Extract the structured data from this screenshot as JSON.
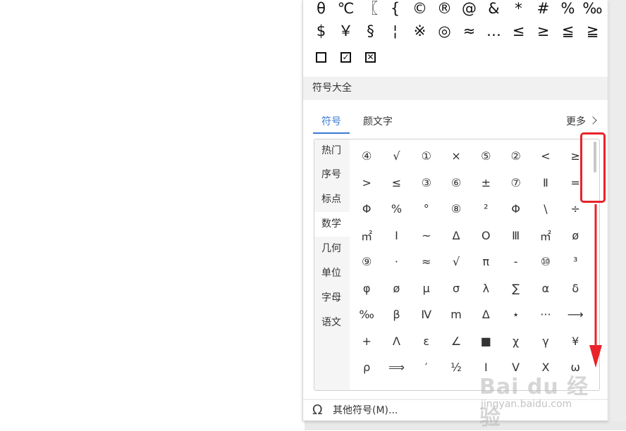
{
  "recent_symbols": {
    "rows": [
      [
        "θ",
        "℃",
        "〖",
        "{",
        "©",
        "®",
        "@",
        "&",
        "*",
        "#",
        "%",
        "‰"
      ],
      [
        "$",
        "￥",
        "§",
        "¦",
        "※",
        "◎",
        "≈",
        "…",
        "≤",
        "≥",
        "≦",
        "≧"
      ]
    ],
    "checkbox_icons": [
      "empty-checkbox-icon",
      "checked-checkbox-icon",
      "crossed-checkbox-icon"
    ]
  },
  "section": {
    "title": "符号大全"
  },
  "tabs": [
    {
      "label": "符号",
      "active": true
    },
    {
      "label": "颜文字",
      "active": false
    }
  ],
  "more": {
    "label": "更多"
  },
  "categories": [
    {
      "label": "热门",
      "active": false
    },
    {
      "label": "序号",
      "active": false
    },
    {
      "label": "标点",
      "active": false
    },
    {
      "label": "数学",
      "active": true
    },
    {
      "label": "几何",
      "active": false
    },
    {
      "label": "单位",
      "active": false
    },
    {
      "label": "字母",
      "active": false
    },
    {
      "label": "语文",
      "active": false
    }
  ],
  "symbols": [
    [
      "④",
      "√",
      "①",
      "×",
      "⑤",
      "②",
      "<",
      "≥"
    ],
    [
      ">",
      "≤",
      "③",
      "⑥",
      "±",
      "⑦",
      "Ⅱ",
      "="
    ],
    [
      "Φ",
      "%",
      "°",
      "⑧",
      "²",
      "Φ",
      "\\",
      "÷"
    ],
    [
      "㎡",
      "Ⅰ",
      "~",
      "Δ",
      "Ο",
      "Ⅲ",
      "㎡",
      "ø"
    ],
    [
      "⑨",
      "·",
      "≈",
      "√",
      "π",
      "-",
      "⑩",
      "³"
    ],
    [
      "φ",
      "ø",
      "μ",
      "σ",
      "λ",
      "∑",
      "α",
      "δ"
    ],
    [
      "‰",
      "β",
      "Ⅳ",
      "m",
      "Δ",
      "⋆",
      "···",
      "⟶"
    ],
    [
      "+",
      "Λ",
      "ε",
      "∠",
      "■",
      "χ",
      "γ",
      "¥"
    ],
    [
      "ρ",
      "⟹",
      "′",
      "½",
      "Ⅰ",
      "Ⅴ",
      "Ⅹ",
      "ω"
    ]
  ],
  "footer": {
    "label": "其他符号(M)..."
  },
  "watermark": {
    "logo": "Bai du 经验",
    "url": "jingyan.baidu.com"
  },
  "colors": {
    "accent": "#3a7bd5",
    "annotation": "#e8232a"
  }
}
